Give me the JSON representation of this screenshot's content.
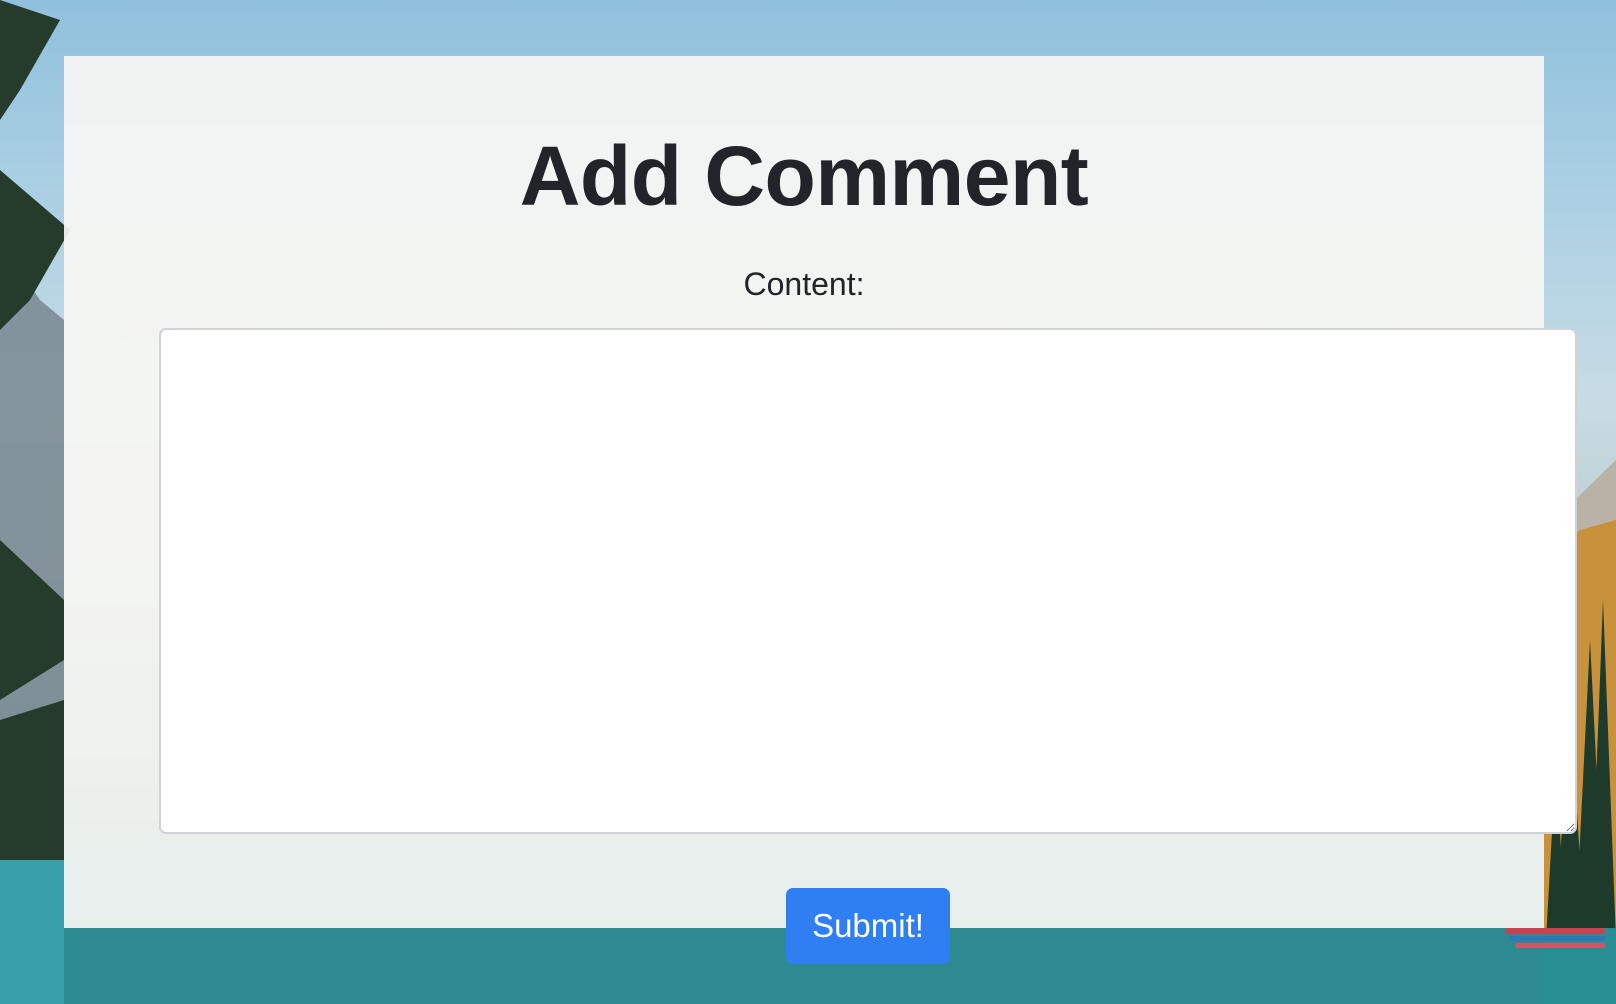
{
  "page": {
    "title": "Add Comment"
  },
  "form": {
    "content_label": "Content:",
    "content_value": "",
    "submit_label": "Submit!"
  },
  "colors": {
    "submit_button": "#2f7ff3",
    "heading_text": "#212529",
    "card_background": "#f6f6f3"
  }
}
